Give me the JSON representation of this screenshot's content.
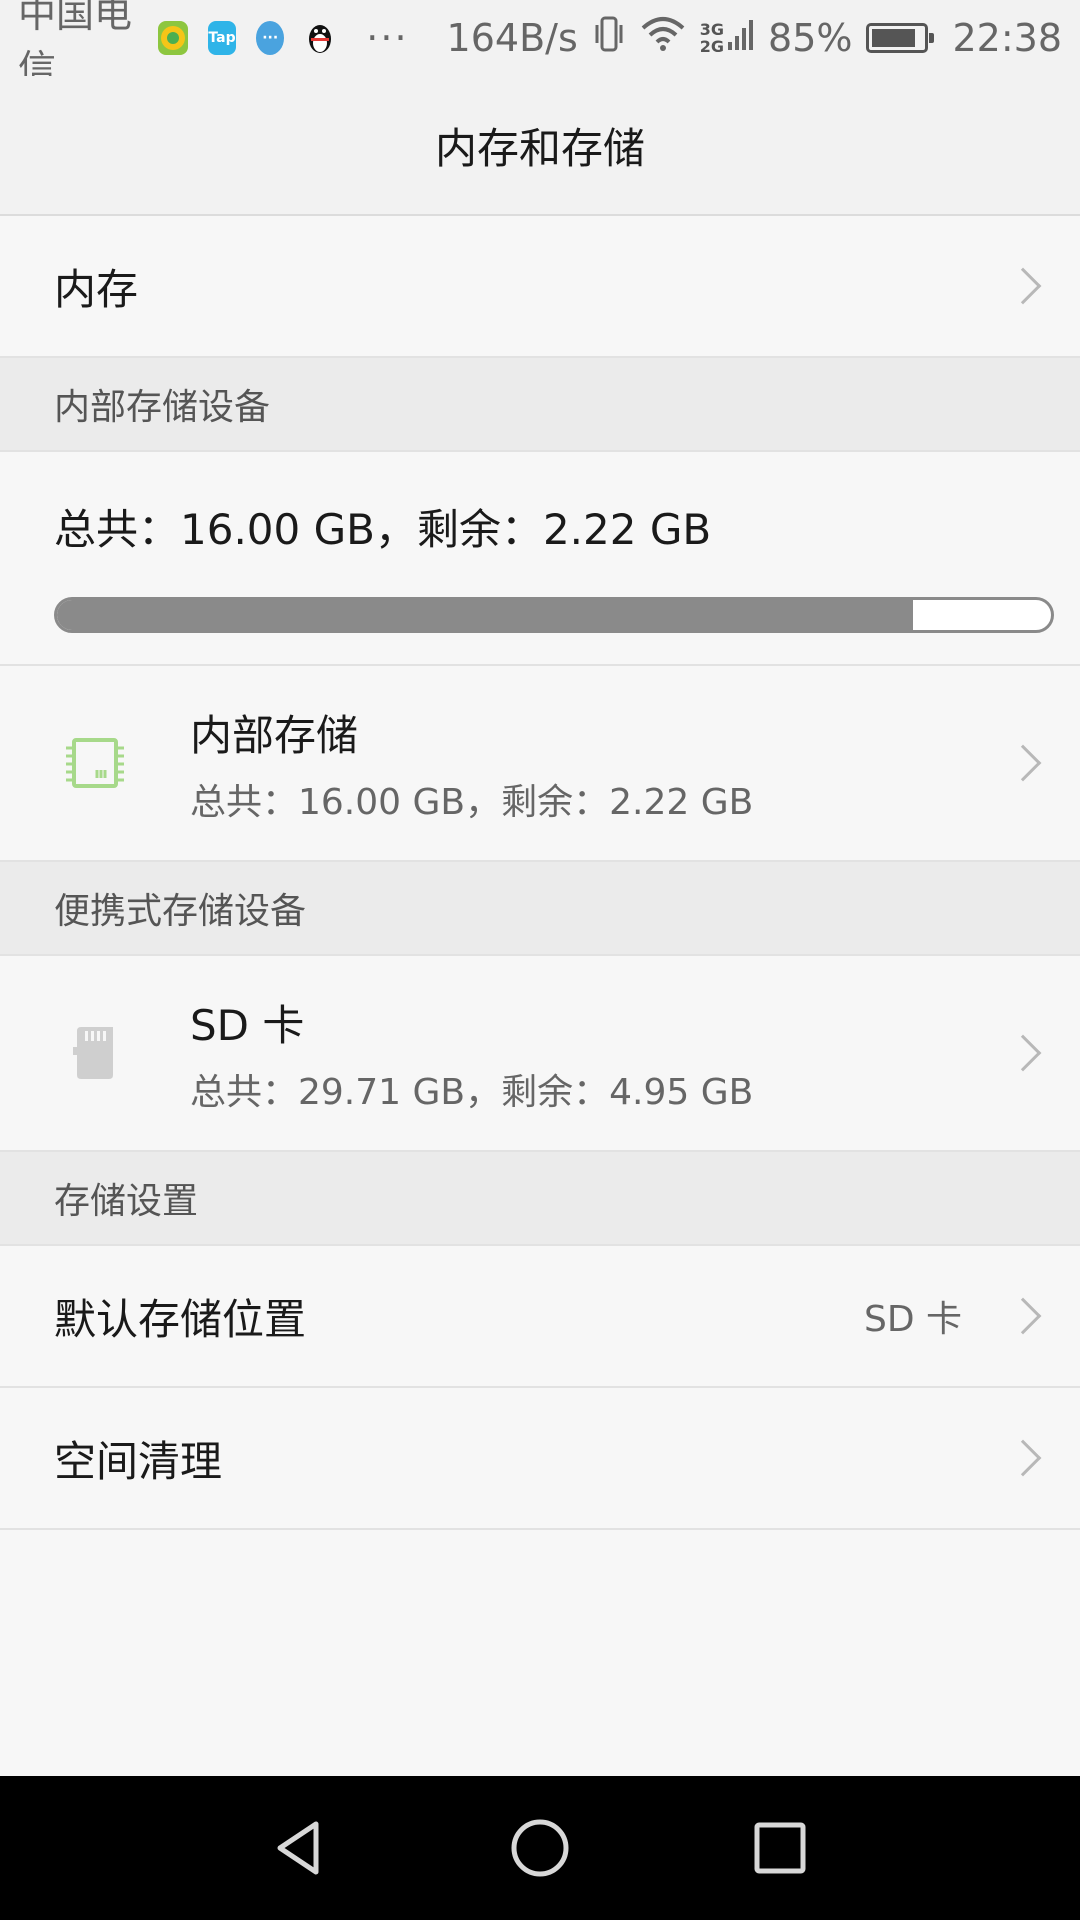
{
  "status_bar": {
    "carrier": "中国电信",
    "notification_icons": [
      "leaf-app-icon",
      "tap-app-icon",
      "message-app-icon",
      "qq-icon"
    ],
    "overflow": "···",
    "net_speed": "164B/s",
    "net_types": [
      "3G",
      "2G"
    ],
    "battery_percent": "85%",
    "battery_level": 0.85,
    "time": "22:38"
  },
  "header": {
    "title": "内存和存储"
  },
  "memory_row": {
    "label": "内存"
  },
  "internal_section": {
    "header": "内部存储设备",
    "summary": "总共：16.00 GB，剩余：2.22 GB",
    "used_fraction": 0.861,
    "device": {
      "title": "内部存储",
      "subtitle": "总共：16.00 GB，剩余：2.22 GB",
      "icon": "chip-icon",
      "icon_color": "#9fd37a"
    }
  },
  "portable_section": {
    "header": "便携式存储设备",
    "device": {
      "title": "SD 卡",
      "subtitle": "总共：29.71 GB，剩余：4.95 GB",
      "icon": "sd-card-icon"
    }
  },
  "settings_section": {
    "header": "存储设置",
    "default_location": {
      "label": "默认存储位置",
      "value": "SD 卡"
    },
    "cleanup": {
      "label": "空间清理"
    }
  },
  "nav": {
    "buttons": [
      "back-icon",
      "home-icon",
      "recents-icon"
    ]
  }
}
